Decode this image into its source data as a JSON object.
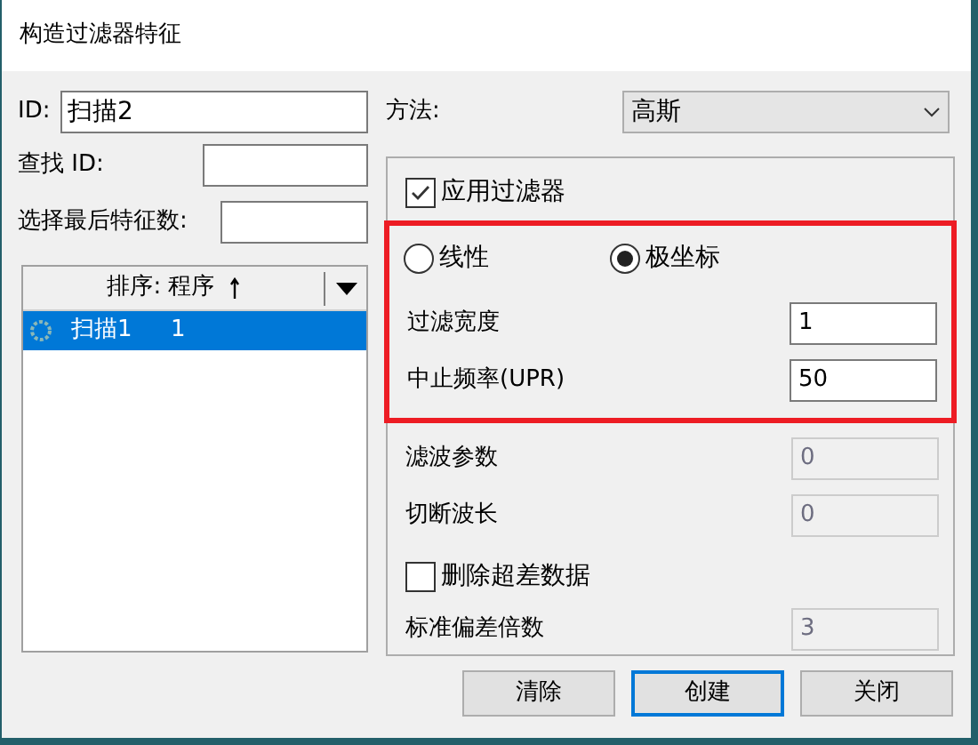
{
  "window": {
    "title": "构造过滤器特征"
  },
  "id_field": {
    "label": "ID:",
    "value": "扫描2"
  },
  "find_id": {
    "label": "查找 ID:"
  },
  "select_last": {
    "label": "选择最后特征数:"
  },
  "feature_list": {
    "header": "排序: 程序",
    "items": [
      {
        "name": "扫描1",
        "number": "1",
        "selected": true
      }
    ]
  },
  "method": {
    "label": "方法:",
    "value": "高斯"
  },
  "apply_filter": {
    "label": "应用过滤器",
    "checked": true
  },
  "highlighted_group": {
    "modes": [
      {
        "label": "线性",
        "selected": false
      },
      {
        "label": "极坐标",
        "selected": true
      }
    ],
    "fields": [
      {
        "label": "过滤宽度",
        "value": "1",
        "disabled": false
      },
      {
        "label": "中止频率(UPR)",
        "value": "50",
        "disabled": false
      }
    ]
  },
  "other_options": [
    {
      "kind": "input",
      "label": "滤波参数",
      "value": "0",
      "disabled": true
    },
    {
      "kind": "input",
      "label": "切断波长",
      "value": "0",
      "disabled": true
    },
    {
      "kind": "checkbox",
      "label": "删除超差数据",
      "checked": false
    },
    {
      "kind": "input",
      "label": "标准偏差倍数",
      "value": "3",
      "disabled": true
    }
  ],
  "buttons": [
    {
      "label": "清除",
      "default": false
    },
    {
      "label": "创建",
      "default": true
    },
    {
      "label": "关闭",
      "default": false
    }
  ]
}
